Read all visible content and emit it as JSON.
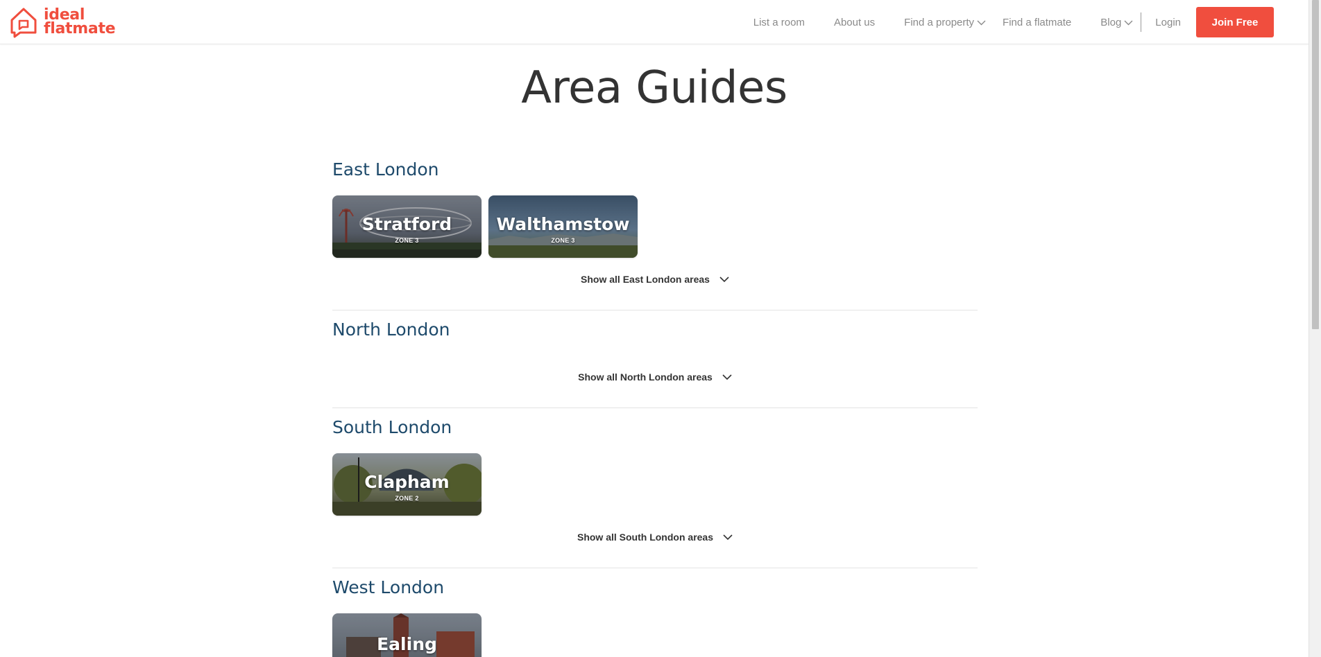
{
  "brand": {
    "line1": "ideal",
    "line2": "flatmate",
    "logo_icon": "house-speech-bubble-icon",
    "accent_color": "#f04e3e"
  },
  "nav": {
    "list_room": "List a room",
    "about": "About us",
    "find_property": "Find a property",
    "find_flatmate": "Find a flatmate",
    "blog": "Blog",
    "login": "Login",
    "join": "Join Free"
  },
  "page": {
    "title": "Area Guides"
  },
  "regions": [
    {
      "title": "East London",
      "show_all": "Show all East London areas",
      "areas": [
        {
          "name": "Stratford",
          "zone": "ZONE 3"
        },
        {
          "name": "Walthamstow",
          "zone": "ZONE 3"
        }
      ]
    },
    {
      "title": "North London",
      "show_all": "Show all North London areas",
      "areas": []
    },
    {
      "title": "South London",
      "show_all": "Show all South London areas",
      "areas": [
        {
          "name": "Clapham",
          "zone": "ZONE 2"
        }
      ]
    },
    {
      "title": "West London",
      "show_all": "",
      "areas": [
        {
          "name": "Ealing",
          "zone": ""
        }
      ]
    }
  ],
  "colors": {
    "region_title": "#1e4a6b",
    "join_button": "#f04e3e"
  }
}
